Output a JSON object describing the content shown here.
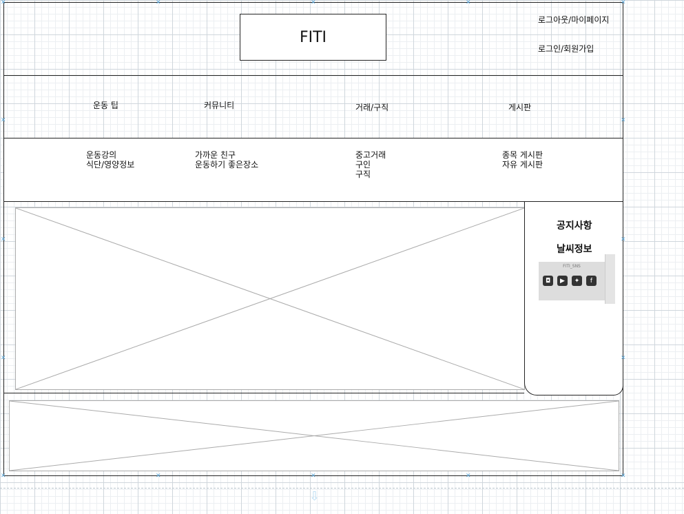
{
  "header": {
    "logo_text": "FITI",
    "account_links": {
      "logout_mypage": "로그아웃/마이페이지",
      "login_signup": "로그인/회원가입"
    }
  },
  "nav": {
    "items": [
      {
        "label": "운동 팁"
      },
      {
        "label": "커뮤니티"
      },
      {
        "label": "거래/구직"
      },
      {
        "label": "게시판"
      }
    ]
  },
  "submenu": {
    "exercise": [
      "운동강의",
      "식단/영양정보"
    ],
    "community": [
      "가까운 친구",
      "운동하기 좋은장소"
    ],
    "trade": [
      "중고거래",
      "구인",
      "구직"
    ],
    "board": [
      "종목 게시판",
      "자유 게시판"
    ]
  },
  "side_panel": {
    "notice": "공지사항",
    "weather": "날씨정보",
    "sns_label": "FITI_SNS",
    "sns_icons": [
      {
        "name": "instagram-icon",
        "glyph": "◘"
      },
      {
        "name": "youtube-icon",
        "glyph": "▶"
      },
      {
        "name": "twitter-icon",
        "glyph": "✦"
      },
      {
        "name": "facebook-icon",
        "glyph": "f"
      }
    ]
  },
  "colors": {
    "line": "#222222",
    "placeholder": "#aaaaaa",
    "handle": "#5aa6d8"
  }
}
